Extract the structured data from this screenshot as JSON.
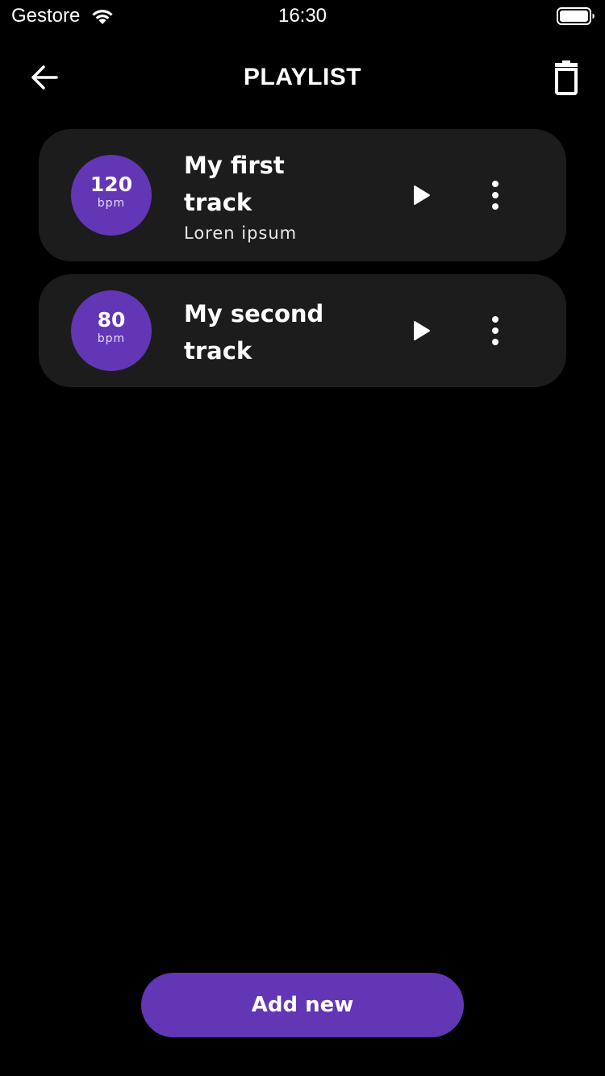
{
  "status_bar": {
    "carrier": "Gestore",
    "time": "16:30",
    "icons": [
      "wifi-icon",
      "battery-icon"
    ]
  },
  "header": {
    "title": "PLAYLIST",
    "back_icon": "arrow-left-icon",
    "delete_icon": "trash-icon"
  },
  "tracks": [
    {
      "bpm": "120",
      "bpm_unit": "bpm",
      "title_line1": "My first",
      "title_line2": "track",
      "subtitle": "Loren ipsum"
    },
    {
      "bpm": "80",
      "bpm_unit": "bpm",
      "title_line1": "My second",
      "title_line2": "track",
      "subtitle": ""
    }
  ],
  "add_button": {
    "label": "Add new"
  },
  "colors": {
    "background": "#000000",
    "card": "#1c1c1c",
    "accent": "#6236b5",
    "text": "#ffffff"
  }
}
